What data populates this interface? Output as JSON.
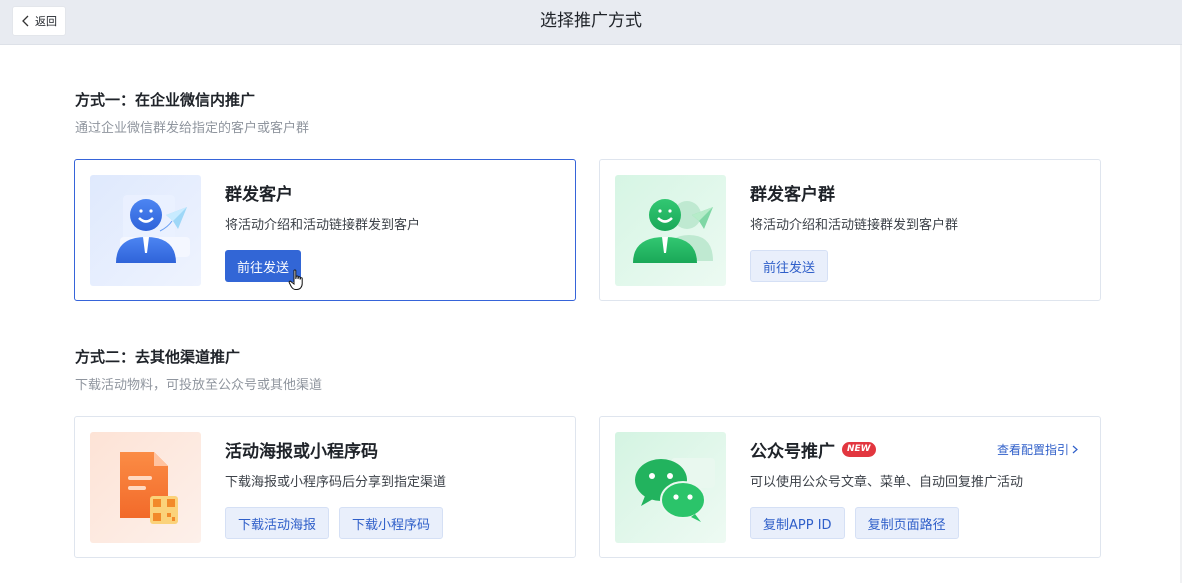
{
  "header": {
    "back_label": "返回",
    "title": "选择推广方式"
  },
  "section1": {
    "title": "方式一：在企业微信内推广",
    "subtitle": "通过企业微信群发给指定的客户或客户群",
    "cards": [
      {
        "title": "群发客户",
        "desc": "将活动介绍和活动链接群发到客户",
        "button": "前往发送",
        "selected": true
      },
      {
        "title": "群发客户群",
        "desc": "将活动介绍和活动链接群发到客户群",
        "button": "前往发送",
        "selected": false
      }
    ]
  },
  "section2": {
    "title": "方式二：去其他渠道推广",
    "subtitle": "下载活动物料，可投放至公众号或其他渠道",
    "cards": [
      {
        "title": "活动海报或小程序码",
        "desc": "下载海报或小程序码后分享到指定渠道",
        "buttons": [
          "下载活动海报",
          "下载小程序码"
        ]
      },
      {
        "title": "公众号推广",
        "badge": "NEW",
        "link": "查看配置指引",
        "desc": "可以使用公众号文章、菜单、自动回复推广活动",
        "buttons": [
          "复制APP ID",
          "复制页面路径"
        ]
      }
    ]
  },
  "icons": {
    "back": "chevron-left-icon",
    "link_arrow": "chevron-right-icon",
    "card1": "person-send-illustration",
    "card2": "group-send-illustration",
    "card3": "document-qrcode-illustration",
    "card4": "wechat-illustration",
    "cursor": "hand-pointer-icon"
  },
  "colors": {
    "primary": "#3266d6",
    "accent_green": "#1fb85e",
    "badge_red": "#e2363f",
    "header_bg": "#e8ebf1"
  }
}
